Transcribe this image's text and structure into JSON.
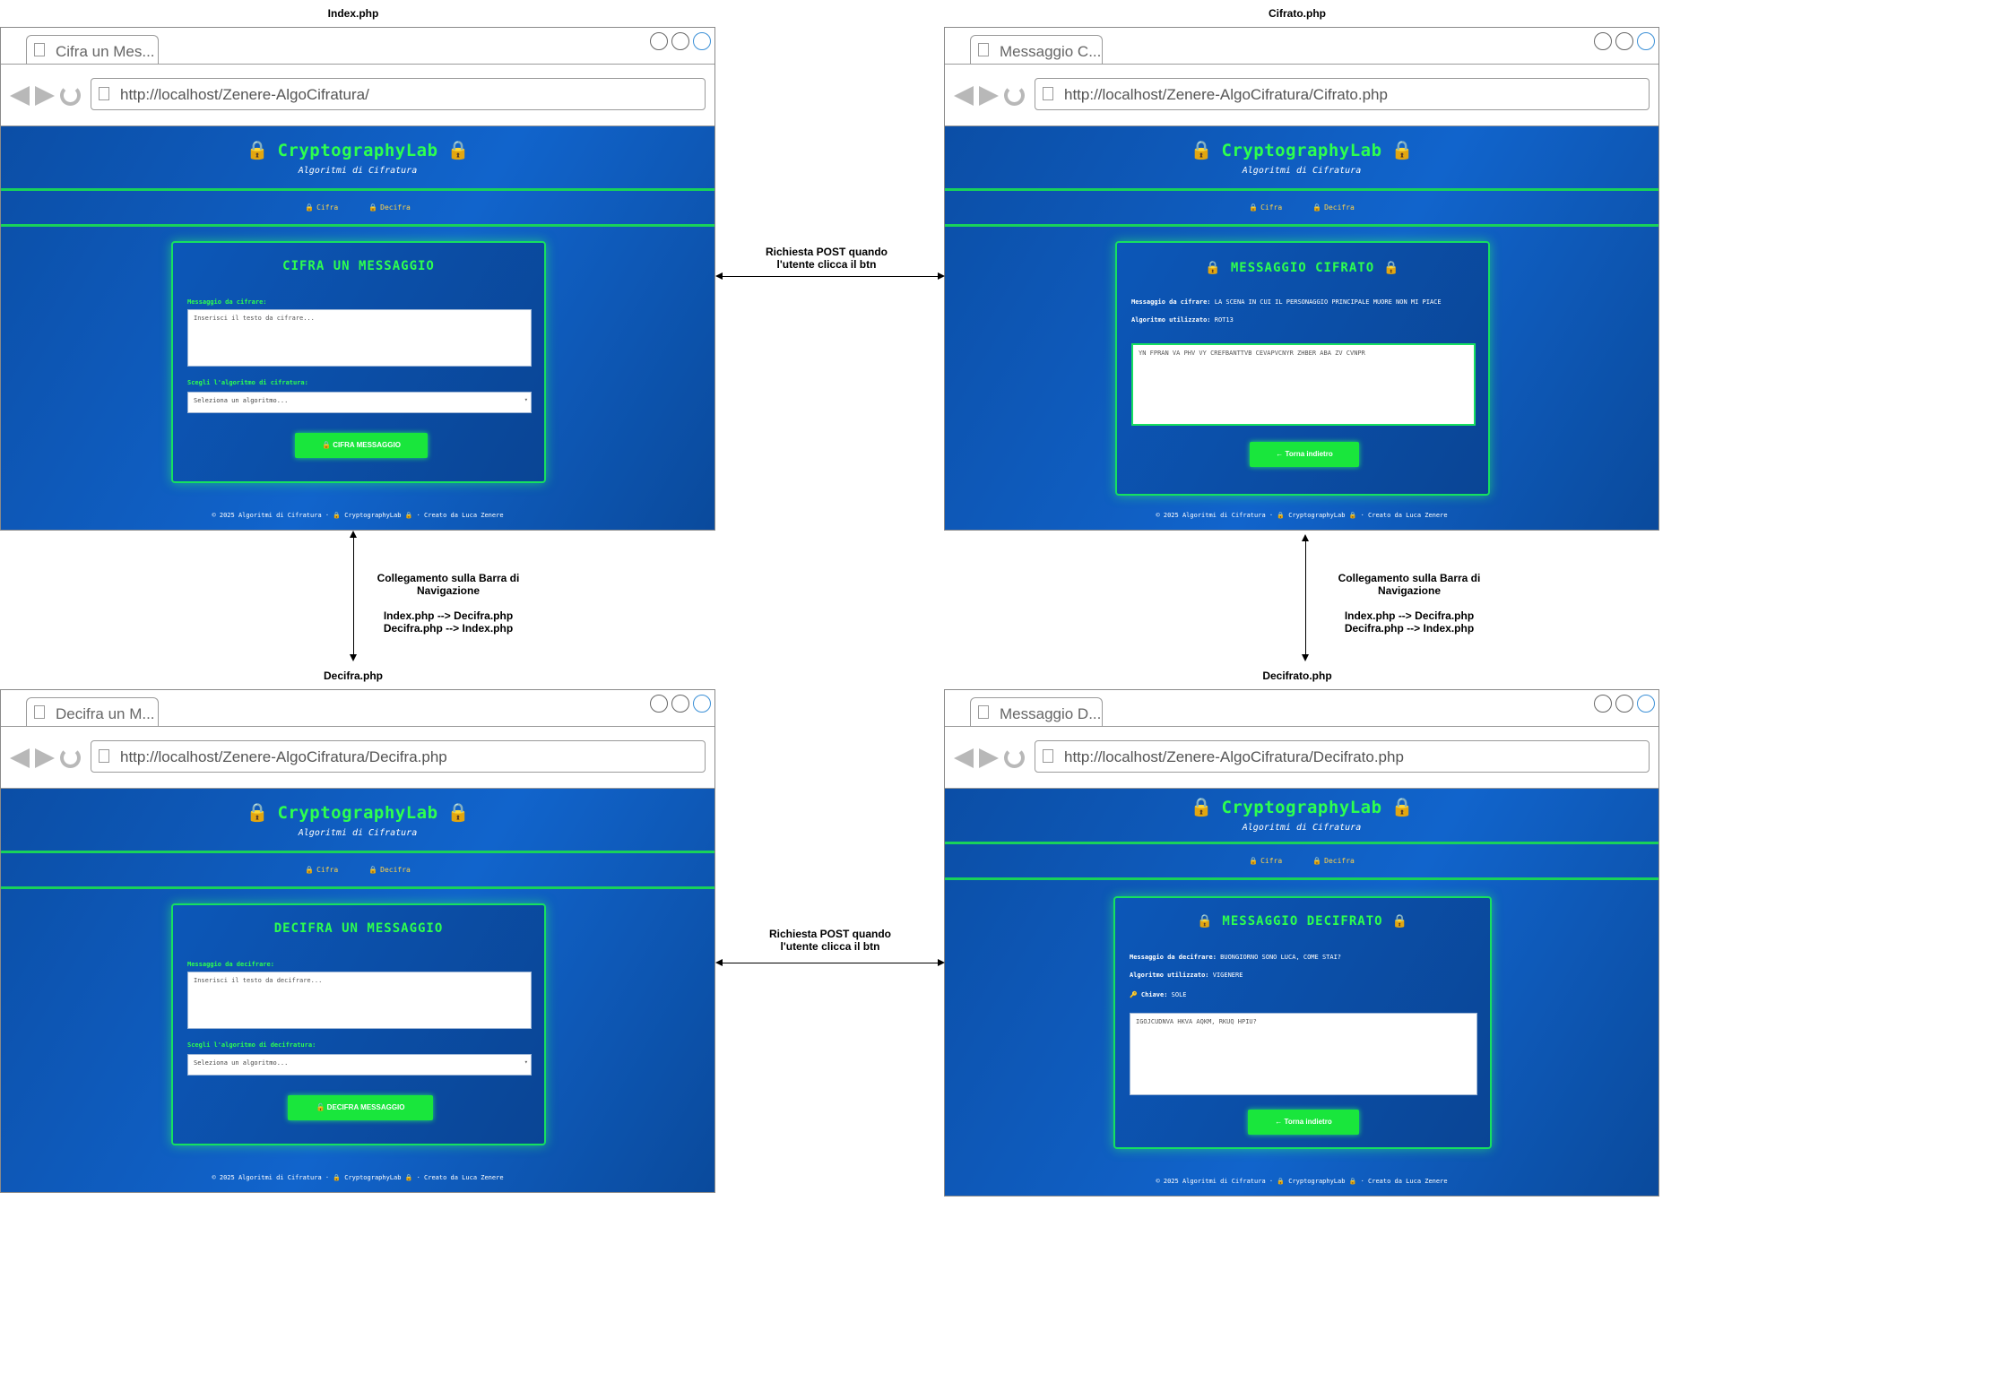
{
  "labels": {
    "index": "Index.php",
    "cifrato": "Cifrato.php",
    "decifra": "Decifra.php",
    "decifrato": "Decifrato.php"
  },
  "notes": {
    "post_top": "Richiesta POST quando\nl'utente clicca il btn",
    "post_bottom": "Richiesta POST quando\nl'utente clicca il btn",
    "nav_left": "Collegamento sulla Barra di\nNavigazione\n\nIndex.php --> Decifra.php\nDecifra.php --> Index.php",
    "nav_right": "Collegamento sulla Barra di\nNavigazione\n\nIndex.php --> Decifra.php\nDecifra.php --> Index.php"
  },
  "site": {
    "brand": "CryptographyLab",
    "lock": "🔒",
    "tagline": "Algoritmi di Cifratura",
    "nav_cifra": "Cifra",
    "nav_decifra": "Decifra",
    "footer_a": "© 2025 Algoritmi di Cifratura · ",
    "footer_b": " CryptographyLab ",
    "footer_c": " · Creato da Luca Zenere"
  },
  "windows": {
    "index": {
      "tab": "Cifra un Mes...",
      "url": "http://localhost/Zenere-AlgoCifratura/",
      "title": "CIFRA UN MESSAGGIO",
      "field_label": "Messaggio da cifrare:",
      "placeholder": "Inserisci il testo da cifrare...",
      "select_label": "Scegli l'algoritmo di cifratura:",
      "select_value": "Seleziona un algoritmo...",
      "button": "🔒 CIFRA MESSAGGIO"
    },
    "cifrato": {
      "tab": "Messaggio C...",
      "url": "http://localhost/Zenere-AlgoCifratura/Cifrato.php",
      "title": "MESSAGGIO CIFRATO",
      "msg_label": "Messaggio da cifrare:",
      "msg_value": "LA SCENA IN CUI IL PERSONAGGIO PRINCIPALE MUORE NON MI PIACE",
      "algo_label": "Algoritmo utilizzato:",
      "algo_value": "ROT13",
      "result": "YN FPRAN VA PHV VY CREFBANTTVB CEVAPVCNYR ZHBER ABA ZV CVNPR",
      "button": "← Torna indietro"
    },
    "decifra": {
      "tab": "Decifra un M...",
      "url": "http://localhost/Zenere-AlgoCifratura/Decifra.php",
      "title": "DECIFRA UN MESSAGGIO",
      "field_label": "Messaggio da decifrare:",
      "placeholder": "Inserisci il testo da decifrare...",
      "select_label": "Scegli l'algoritmo di decifratura:",
      "select_value": "Seleziona un algoritmo...",
      "button": "🔓 DECIFRA MESSAGGIO"
    },
    "decifrato": {
      "tab": "Messaggio D...",
      "url": "http://localhost/Zenere-AlgoCifratura/Decifrato.php",
      "title": "MESSAGGIO DECIFRATO",
      "msg_label": "Messaggio da decifrare:",
      "msg_value": "BUONGIORNO SONO LUCA, COME STAI?",
      "algo_label": "Algoritmo utilizzato:",
      "algo_value": "VIGENERE",
      "key_label": "🔑 Chiave:",
      "key_value": "SOLE",
      "result": "IGOJCUDNVA HKVA AQKM, RKUQ HPIU?",
      "button": "← Torna indietro"
    }
  }
}
